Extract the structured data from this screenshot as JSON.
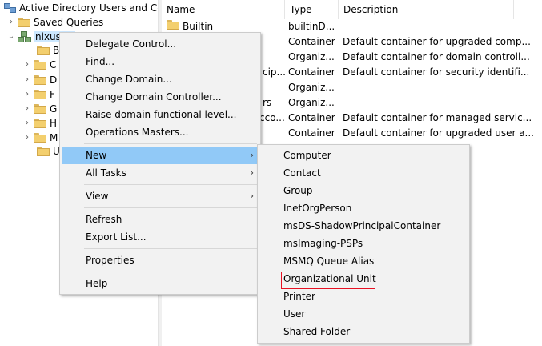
{
  "tree": {
    "root": "Active Directory Users and Com",
    "saved_queries": "Saved Queries",
    "domain": "nixus",
    "children": [
      "B",
      "C",
      "D",
      "F",
      "G",
      "H",
      "M",
      "U"
    ]
  },
  "list": {
    "columns": [
      "Name",
      "Type",
      "Description"
    ],
    "rows": [
      {
        "name": "Builtin",
        "type": "builtinD...",
        "desc": ""
      },
      {
        "name": "",
        "type": "Container",
        "desc": "Default container for upgraded comp..."
      },
      {
        "name": "",
        "type": "Organiz...",
        "desc": "Default container for domain controll..."
      },
      {
        "name": "cip...",
        "type": "Container",
        "desc": "Default container for security identifi..."
      },
      {
        "name": "",
        "type": "Organiz...",
        "desc": ""
      },
      {
        "name": "rs",
        "type": "Organiz...",
        "desc": ""
      },
      {
        "name": "cco...",
        "type": "Container",
        "desc": "Default container for managed servic..."
      },
      {
        "name": "",
        "type": "Container",
        "desc": "Default container for upgraded user a..."
      }
    ]
  },
  "context_menu": {
    "items": [
      "Delegate Control...",
      "Find...",
      "Change Domain...",
      "Change Domain Controller...",
      "Raise domain functional level...",
      "Operations Masters...",
      "New",
      "All Tasks",
      "View",
      "Refresh",
      "Export List...",
      "Properties",
      "Help"
    ],
    "highlighted": "New"
  },
  "new_submenu": {
    "items": [
      "Computer",
      "Contact",
      "Group",
      "InetOrgPerson",
      "msDS-ShadowPrincipalContainer",
      "msImaging-PSPs",
      "MSMQ Queue Alias",
      "Organizational Unit",
      "Printer",
      "User",
      "Shared Folder"
    ],
    "outlined": "Organizational Unit"
  },
  "colors": {
    "highlight": "#91c9f7",
    "selection": "#cce8ff",
    "outline": "#e81123",
    "menu_bg": "#f2f2f2"
  }
}
